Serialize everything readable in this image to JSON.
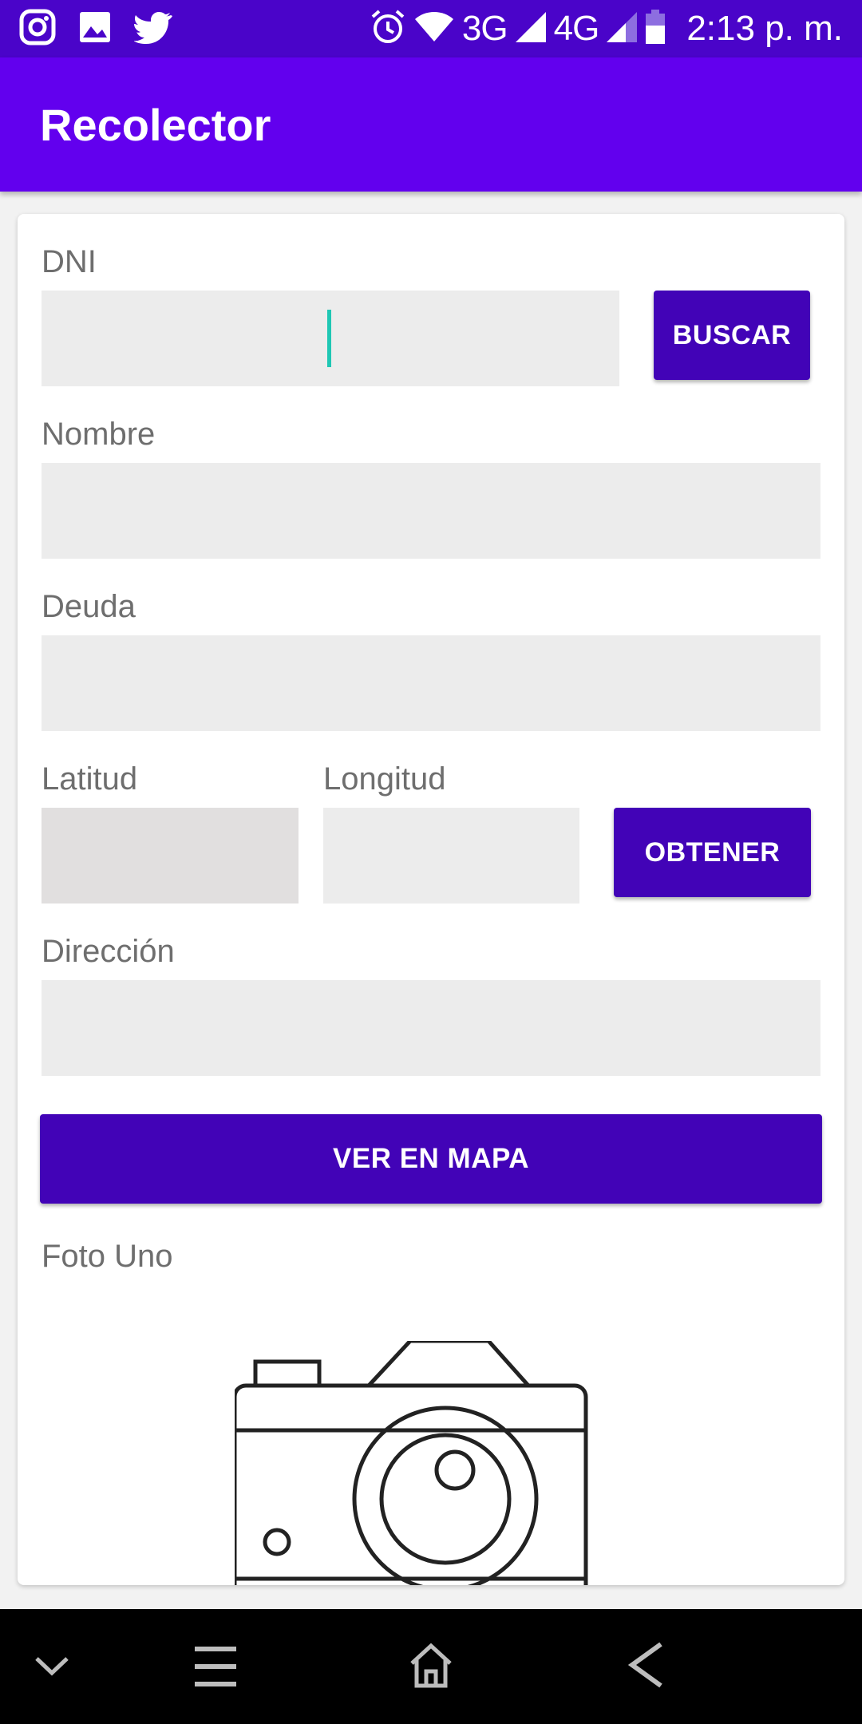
{
  "status_bar": {
    "left_icons": [
      "instagram-icon",
      "gallery-icon",
      "twitter-icon"
    ],
    "network_3g": "3G",
    "network_4g": "4G",
    "time": "2:13 p. m."
  },
  "app_bar": {
    "title": "Recolector"
  },
  "form": {
    "dni_label": "DNI",
    "dni_value": "",
    "search_button": "BUSCAR",
    "name_label": "Nombre",
    "name_value": "",
    "debt_label": "Deuda",
    "debt_value": "",
    "latitude_label": "Latitud",
    "latitude_value": "",
    "longitude_label": "Longitud",
    "longitude_value": "",
    "obtain_button": "OBTENER",
    "address_label": "Dirección",
    "address_value": "",
    "map_button": "VER EN MAPA",
    "photo_one_label": "Foto Uno"
  },
  "colors": {
    "status_bar": "#4a04c9",
    "app_bar": "#6200ee",
    "button": "#4203b7",
    "field": "#ececec",
    "cursor": "#1fc7b4"
  }
}
